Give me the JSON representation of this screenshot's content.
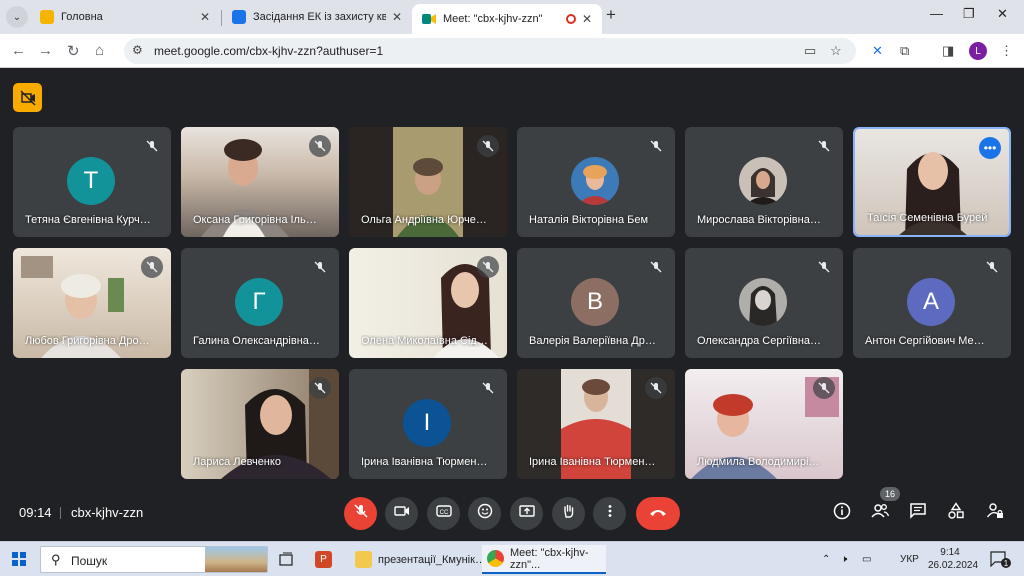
{
  "browser": {
    "tabs": [
      {
        "title": "Головна",
        "favicon_color": "#f4b400"
      },
      {
        "title": "Засідання ЕК із захисту кваліфі",
        "favicon_color": "#1a73e8"
      },
      {
        "title": "Meet: \"cbx-kjhv-zzn\"",
        "favicon_color": "#00897b",
        "recording": true
      }
    ],
    "new_tab": "+",
    "url": "meet.google.com/cbx-kjhv-zzn?authuser=1",
    "profile_initial": "L"
  },
  "meet": {
    "participants": [
      {
        "name": "Тетяна Євгенівна Курч…",
        "initial": "Т",
        "avatar_color": "#12939a"
      },
      {
        "name": "Оксана Григорівна Іль…",
        "video": true,
        "bg": "#bfae9c"
      },
      {
        "name": "Ольга Андріївна Юрче…",
        "video": true,
        "bg": "#9b8a62"
      },
      {
        "name": "Наталія Вікторівна Бем",
        "photo": true,
        "photo_color": "#e8a35b"
      },
      {
        "name": "Мирослава Вікторівна…",
        "photo": true,
        "photo_color": "#2b2321"
      },
      {
        "name": "Таїсія Семенівна Бурей",
        "video": true,
        "bg": "#d9d0c8",
        "selected": true
      },
      {
        "name": "Любов Григорівна Дро…",
        "video": true,
        "bg": "#c9b9a6"
      },
      {
        "name": "Галина Олександрівна…",
        "initial": "Г",
        "avatar_color": "#12939a"
      },
      {
        "name": "Олена Миколаївна Сід…",
        "video": true,
        "bg": "#e6e1d4"
      },
      {
        "name": "Валерія Валеріївна Др…",
        "initial": "В",
        "avatar_color": "#8d6e63"
      },
      {
        "name": "Олександра Сергіївна…",
        "photo": true,
        "photo_color": "#7d7b78"
      },
      {
        "name": "Антон Сергійович Ме…",
        "initial": "А",
        "avatar_color": "#5c6bc0"
      },
      {
        "name": "Лариса Левченко",
        "video": true,
        "bg": "#b6a58e"
      },
      {
        "name": "Ірина Іванівна Тюрмен…",
        "initial": "І",
        "avatar_color": "#0b5394"
      },
      {
        "name": "Ірина Іванівна Тюрмен…",
        "video": true,
        "bg": "#cfc8c3"
      },
      {
        "name": "Людмила Володимирі…",
        "video": true,
        "bg": "#c9b7bd"
      }
    ],
    "time": "09:14",
    "meeting_code": "cbx-kjhv-zzn",
    "people_count": "16"
  },
  "taskbar": {
    "search_label": "Пошук",
    "items": [
      {
        "label": "презентації_Кмунік…",
        "icon_color": "#f2c94c"
      },
      {
        "label": "Meet: \"cbx-kjhv-zzn\"...",
        "icon_color": "#1a73e8"
      }
    ],
    "lang": "УКР",
    "time": "9:14",
    "date": "26.02.2024",
    "notifications": "1"
  },
  "colors": {
    "accent": "#1a73e8",
    "danger": "#ea4335",
    "tile_bg": "#3c4043"
  }
}
